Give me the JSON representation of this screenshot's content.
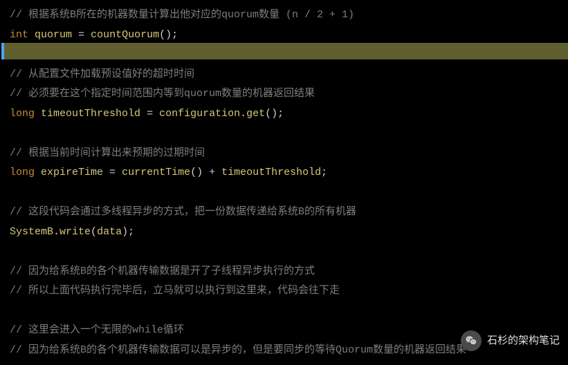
{
  "code": {
    "l1_comment": "// 根据系统B所在的机器数量计算出他对应的quorum数量 (n / 2 + 1)",
    "l2_kw": "int",
    "l2_ident": "quorum",
    "l2_eq": " = ",
    "l2_func": "countQuorum",
    "l2_tail": "();",
    "l3_comment": "// 从配置文件加载预设值好的超时时间",
    "l4_comment": "// 必须要在这个指定时间范围内等到quorum数量的机器返回结果",
    "l5_kw": "long",
    "l5_ident": "timeoutThreshold",
    "l5_eq": " = ",
    "l5_obj": "configuration",
    "l5_dot": ".",
    "l5_func": "get",
    "l5_tail": "();",
    "l6_comment": "// 根据当前时间计算出来预期的过期时间",
    "l7_kw": "long",
    "l7_ident": "expireTime",
    "l7_eq": " = ",
    "l7_func": "currentTime",
    "l7_mid": "() + ",
    "l7_ident2": "timeoutThreshold",
    "l7_tail": ";",
    "l8_comment": "// 这段代码会通过多线程异步的方式，把一份数据传递给系统B的所有机器",
    "l9_obj": "SystemB",
    "l9_dot": ".",
    "l9_func": "write",
    "l9_open": "(",
    "l9_arg": "data",
    "l9_close": ");",
    "l10_comment": "// 因为给系统B的各个机器传输数据是开了子线程异步执行的方式",
    "l11_comment": "// 所以上面代码执行完毕后，立马就可以执行到这里来，代码会往下走",
    "l12_comment": "// 这里会进入一个无限的while循环",
    "l13_comment": "// 因为给系统B的各个机器传输数据可以是异步的，但是要同步的等待Quorum数量的机器返回结果"
  },
  "badge": {
    "text": "石杉的架构笔记"
  }
}
